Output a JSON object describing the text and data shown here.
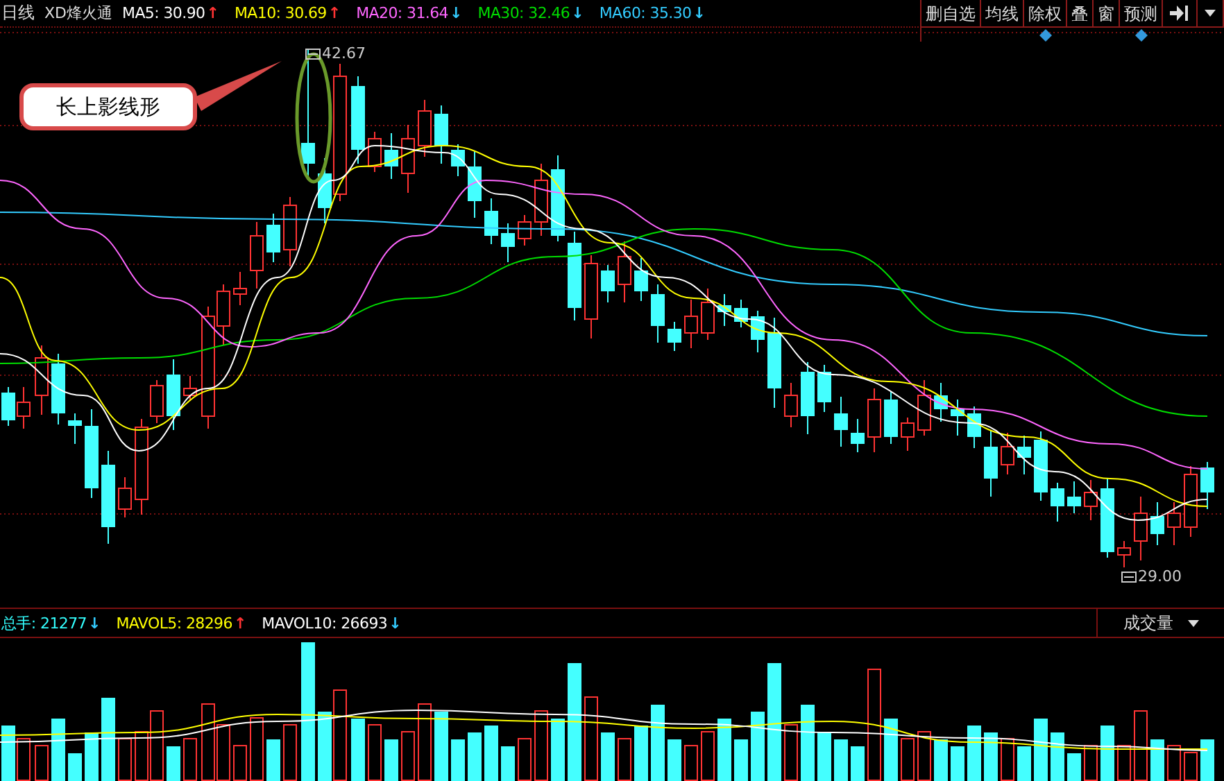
{
  "header": {
    "period": "日线",
    "stock": "XD烽火通",
    "indicators": [
      {
        "label": "MA5: 30.90",
        "arrow": {
          "glyph": "↑",
          "color": "#ff3333"
        },
        "color": "#ffffff"
      },
      {
        "label": "MA10: 30.69",
        "arrow": {
          "glyph": "↑",
          "color": "#ff3333"
        },
        "color": "#ffff00"
      },
      {
        "label": "MA20: 31.64",
        "arrow": {
          "glyph": "↓",
          "color": "#33ccff"
        },
        "color": "#ff66ff"
      },
      {
        "label": "MA30: 32.46",
        "arrow": {
          "glyph": "↓",
          "color": "#33ccff"
        },
        "color": "#00dd00"
      },
      {
        "label": "MA60: 35.30",
        "arrow": {
          "glyph": "↓",
          "color": "#33ccff"
        },
        "color": "#33ccff"
      }
    ]
  },
  "toolbar": {
    "buttons": [
      {
        "label": "删自选",
        "marked": false
      },
      {
        "label": "均线",
        "marked": false
      },
      {
        "label": "除权",
        "marked": true
      },
      {
        "label": "叠",
        "marked": false
      },
      {
        "label": "窗",
        "marked": false
      },
      {
        "label": "预测",
        "marked": true
      }
    ]
  },
  "price_chart": {
    "high_label": "42.67",
    "low_label": "29.00",
    "callout": "长上影线形"
  },
  "volume": {
    "indicators": [
      {
        "label": "总手: 21277",
        "arrow": {
          "glyph": "↓",
          "color": "#33ccff"
        },
        "color": "#33ffff"
      },
      {
        "label": "MAVOL5: 28296",
        "arrow": {
          "glyph": "↑",
          "color": "#ff3333"
        },
        "color": "#ffff00"
      },
      {
        "label": "MAVOL10: 26693",
        "arrow": {
          "glyph": "↓",
          "color": "#33ccff"
        },
        "color": "#ffffff"
      }
    ],
    "selector": "成交量"
  }
}
